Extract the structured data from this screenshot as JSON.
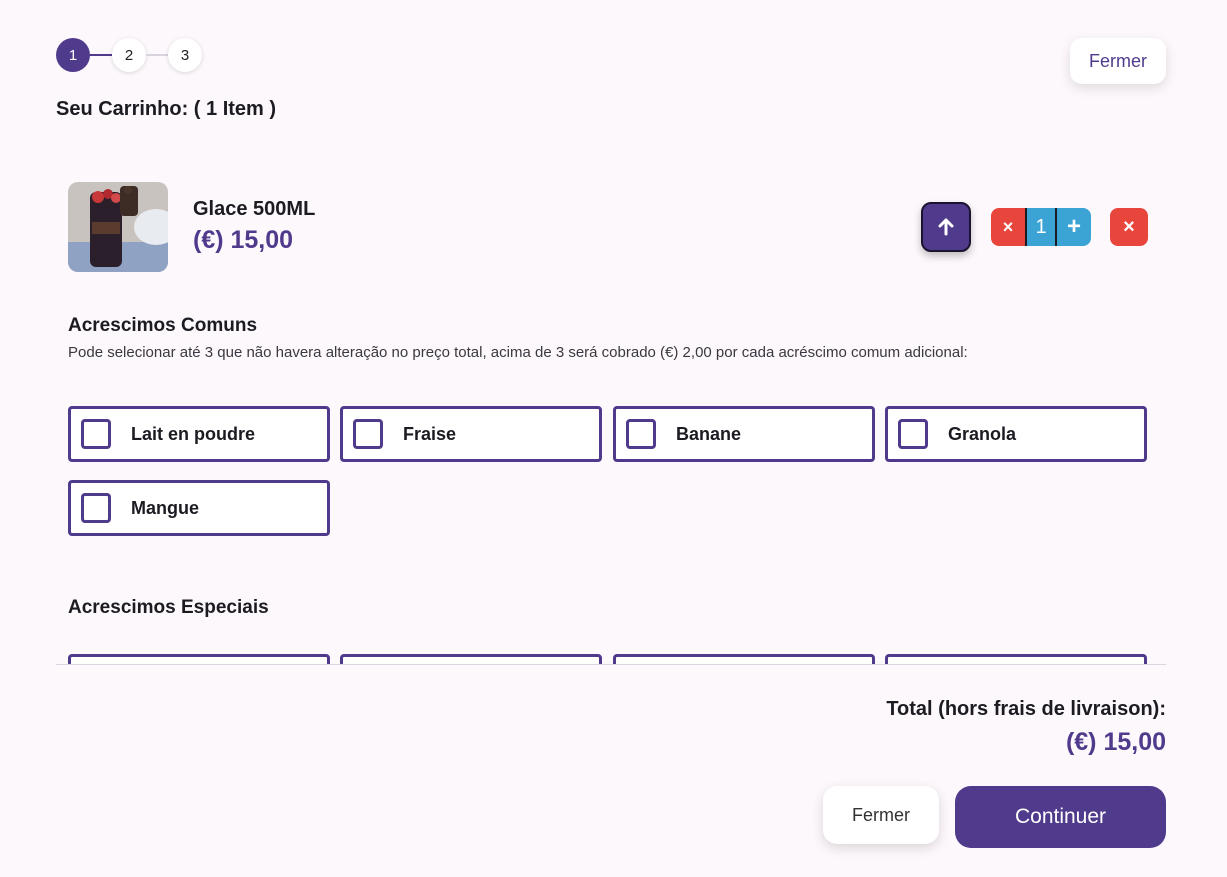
{
  "stepper": {
    "steps": [
      "1",
      "2",
      "3"
    ],
    "active_step": 1
  },
  "header": {
    "close_label": "Fermer",
    "cart_title": "Seu Carrinho: ( 1 Item )"
  },
  "item": {
    "name": "Glace 500ML",
    "price": "(€) 15,00",
    "quantity": "1",
    "minus_symbol": "×",
    "plus_symbol": "+",
    "remove_symbol": "×",
    "image_icon": "ice-cream-photo"
  },
  "common_extras": {
    "title": "Acrescimos Comuns",
    "description": "Pode selecionar até 3 que não havera alteração no preço total, acima de 3 será cobrado (€) 2,00 por cada acréscimo comum adicional:",
    "options": [
      "Lait en poudre",
      "Fraise",
      "Banane",
      "Granola",
      "Mangue"
    ]
  },
  "special_extras": {
    "title": "Acrescimos Especiais"
  },
  "footer": {
    "total_label": "Total (hors frais de livraison):",
    "total_value": "(€) 15,00",
    "close_label": "Fermer",
    "continue_label": "Continuer"
  },
  "colors": {
    "accent": "#503a8c",
    "danger": "#e8453c",
    "qty": "#3ca4d4",
    "background": "#fdf8fc"
  }
}
